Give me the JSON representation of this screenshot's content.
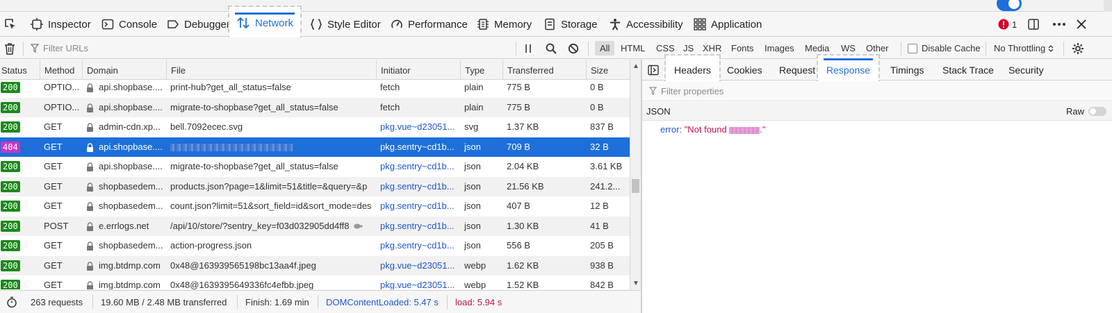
{
  "toolbox": {
    "tabs": [
      {
        "label": "Inspector",
        "icon": "inspector-icon"
      },
      {
        "label": "Console",
        "icon": "console-icon"
      },
      {
        "label": "Debugger",
        "icon": "debugger-icon"
      },
      {
        "label": "Network",
        "icon": "network-icon",
        "selected": true
      },
      {
        "label": "Style Editor",
        "icon": "style-editor-icon"
      },
      {
        "label": "Performance",
        "icon": "performance-icon"
      },
      {
        "label": "Memory",
        "icon": "memory-icon"
      },
      {
        "label": "Storage",
        "icon": "storage-icon"
      },
      {
        "label": "Accessibility",
        "icon": "accessibility-icon"
      },
      {
        "label": "Application",
        "icon": "application-icon"
      }
    ],
    "error_count": "1"
  },
  "filterbar": {
    "filter_placeholder": "Filter URLs",
    "types": [
      "All",
      "HTML",
      "CSS",
      "JS",
      "XHR",
      "Fonts",
      "Images",
      "Media",
      "WS",
      "Other"
    ],
    "active_type": "All",
    "disable_cache_label": "Disable Cache",
    "disable_cache_checked": false,
    "throttling": "No Throttling"
  },
  "table": {
    "columns": [
      "Status",
      "Method",
      "Domain",
      "File",
      "Initiator",
      "Type",
      "Transferred",
      "Size"
    ],
    "rows": [
      {
        "status": "200",
        "method": "OPTIO...",
        "domain": "api.shopbase....",
        "file": "print-hub?get_all_status=false",
        "initiator": "fetch",
        "type": "plain",
        "transferred": "775 B",
        "size": "0 B"
      },
      {
        "status": "200",
        "method": "OPTIO...",
        "domain": "api.shopbase....",
        "file": "migrate-to-shopbase?get_all_status=false",
        "initiator": "fetch",
        "type": "plain",
        "transferred": "775 B",
        "size": "0 B"
      },
      {
        "status": "200",
        "method": "GET",
        "domain": "admin-cdn.xp...",
        "file": "bell.7092ecec.svg",
        "initiator": "pkg.vue~d23051...",
        "type": "svg",
        "transferred": "1.37 KB",
        "size": "837 B"
      },
      {
        "status": "404",
        "method": "GET",
        "domain": "api.shopbase....",
        "file": "",
        "initiator": "pkg.sentry~cd1b...",
        "type": "json",
        "transferred": "709 B",
        "size": "32 B",
        "selected": true
      },
      {
        "status": "200",
        "method": "GET",
        "domain": "api.shopbase....",
        "file": "migrate-to-shopbase?get_all_status=false",
        "initiator": "pkg.sentry~cd1b...",
        "type": "json",
        "transferred": "2.04 KB",
        "size": "3.61 KB"
      },
      {
        "status": "200",
        "method": "GET",
        "domain": "shopbasedem...",
        "file": "products.json?page=1&limit=51&title=&query=&p",
        "initiator": "pkg.sentry~cd1b...",
        "type": "json",
        "transferred": "21.56 KB",
        "size": "241.2..."
      },
      {
        "status": "200",
        "method": "GET",
        "domain": "shopbasedem...",
        "file": "count.json?limit=51&sort_field=id&sort_mode=des",
        "initiator": "pkg.sentry~cd1b...",
        "type": "json",
        "transferred": "407 B",
        "size": "12 B"
      },
      {
        "status": "200",
        "method": "POST",
        "domain": "e.errlogs.net",
        "file": "/api/10/store/?sentry_key=f03d032905dd4ff8",
        "initiator": "pkg.sentry~cd1b...",
        "type": "json",
        "transferred": "1.30 KB",
        "size": "41 B"
      },
      {
        "status": "200",
        "method": "GET",
        "domain": "shopbasedem...",
        "file": "action-progress.json",
        "initiator": "pkg.sentry~cd1b...",
        "type": "json",
        "transferred": "556 B",
        "size": "205 B"
      },
      {
        "status": "200",
        "method": "GET",
        "domain": "img.btdmp.com",
        "file": "0x48@163939565198bc13aa4f.jpeg",
        "initiator": "pkg.vue~d23051...",
        "type": "webp",
        "transferred": "1.62 KB",
        "size": "938 B"
      },
      {
        "status": "200",
        "method": "GET",
        "domain": "img.btdmp.com",
        "file": "0x48@1639395649336fc4efbb.jpeg",
        "initiator": "pkg.vue~d23051...",
        "type": "webp",
        "transferred": "1.52 KB",
        "size": "842 B"
      }
    ]
  },
  "sidebar": {
    "tabs": [
      "Headers",
      "Cookies",
      "Request",
      "Response",
      "Timings",
      "Stack Trace",
      "Security"
    ],
    "selected_tab": "Response",
    "filter_placeholder": "Filter properties",
    "json_label": "JSON",
    "raw_label": "Raw",
    "raw_on": false,
    "json_key": "error",
    "json_value_prefix": "\"Not found ",
    "json_value_suffix": ".\""
  },
  "statusbar": {
    "requests": "263 requests",
    "transferred": "19.60 MB / 2.48 MB transferred",
    "finish": "Finish: 1.69 min",
    "domcontentloaded": "DOMContentLoaded: 5.47 s",
    "load": "load: 5.94 s"
  },
  "colors": {
    "accent": "#1e6fd9",
    "status_ok": "#1a8a1a",
    "status_404": "#c637c6",
    "dcl": "#1e57c8",
    "load": "#c0114c"
  }
}
